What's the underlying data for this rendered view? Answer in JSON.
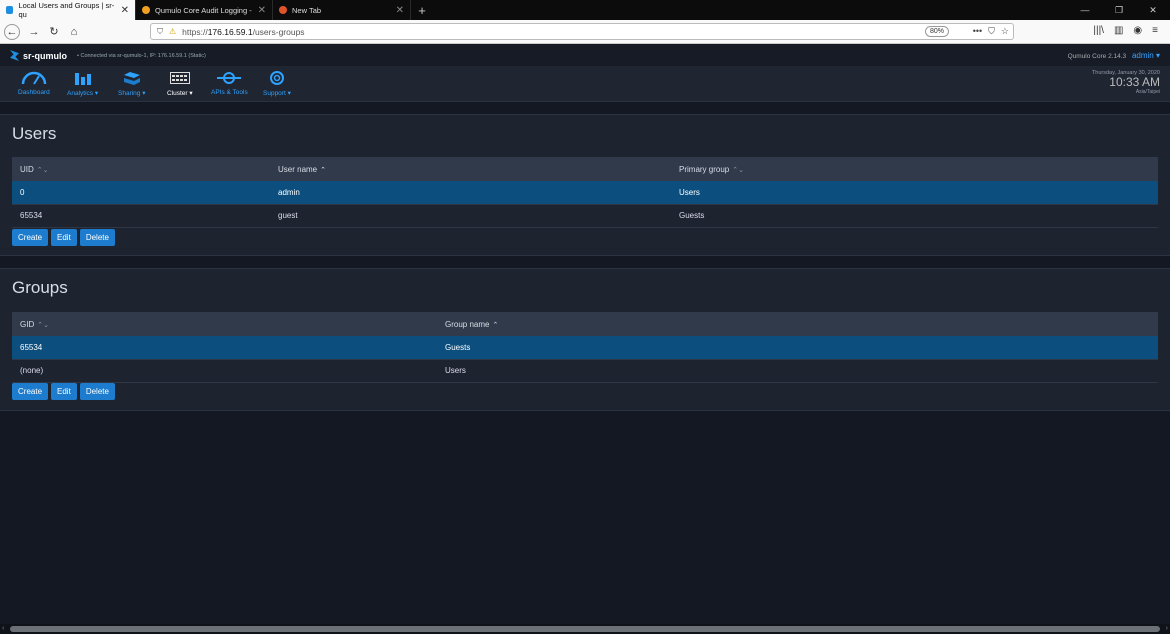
{
  "browser": {
    "tabs": [
      {
        "label": "Local Users and Groups | sr-qu"
      },
      {
        "label": "Qumulo Core Audit Logging -"
      },
      {
        "label": "New Tab"
      }
    ],
    "url_scheme": "https://",
    "url_host": "176.16.59.1",
    "url_path": "/users-groups",
    "zoom": "80%"
  },
  "app": {
    "brand": "sr-qumulo",
    "connection": "Connected via sr-qumulo-1, IP: 176.16.59.1 (Static)",
    "version": "Qumulo Core 2.14.3",
    "user": "admin ▾"
  },
  "menu": {
    "dashboard": "Dashboard",
    "analytics": "Analytics ▾",
    "sharing": "Sharing ▾",
    "cluster": "Cluster ▾",
    "apis": "APIs & Tools",
    "support": "Support ▾"
  },
  "clock": {
    "date": "Thursday, January 30, 2020",
    "time": "10:33 AM",
    "zone": "Asia/Taipei"
  },
  "users": {
    "title": "Users",
    "headers": {
      "uid": "UID",
      "name": "User name",
      "group": "Primary group"
    },
    "rows": [
      {
        "uid": "0",
        "name": "admin",
        "group": "Users"
      },
      {
        "uid": "65534",
        "name": "guest",
        "group": "Guests"
      }
    ]
  },
  "groups": {
    "title": "Groups",
    "headers": {
      "gid": "GID",
      "name": "Group name"
    },
    "rows": [
      {
        "gid": "65534",
        "name": "Guests"
      },
      {
        "gid": "(none)",
        "name": "Users"
      }
    ]
  },
  "buttons": {
    "create": "Create",
    "edit": "Edit",
    "delete": "Delete"
  },
  "colors": {
    "accent": "#1d7ccd",
    "selected_row": "#0c4f7f",
    "link": "#2ea2ff"
  }
}
